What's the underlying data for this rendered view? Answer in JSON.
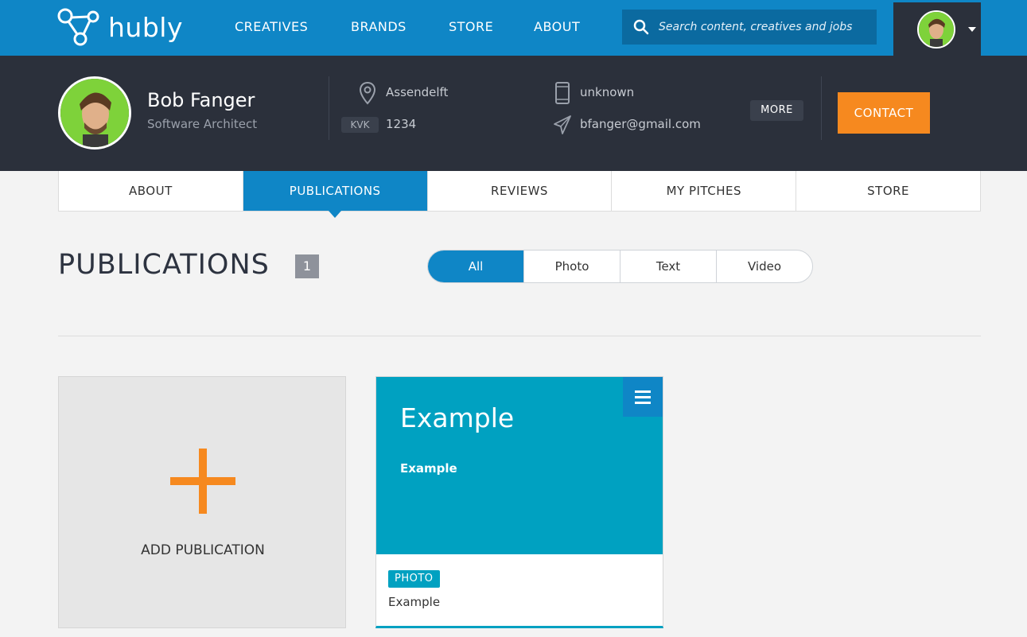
{
  "brand": {
    "name": "hubly"
  },
  "nav": {
    "links": [
      "CREATIVES",
      "BRANDS",
      "STORE",
      "ABOUT"
    ],
    "search_placeholder": "Search content, creatives and jobs"
  },
  "profile": {
    "name": "Bob Fanger",
    "role": "Software Architect",
    "location": "Assendelft",
    "kvk_label": "KVK",
    "kvk_value": "1234",
    "phone": "unknown",
    "email": "bfanger@gmail.com",
    "more_label": "MORE",
    "contact_label": "CONTACT"
  },
  "tabs": [
    {
      "label": "ABOUT",
      "active": false
    },
    {
      "label": "PUBLICATIONS",
      "active": true
    },
    {
      "label": "REVIEWS",
      "active": false
    },
    {
      "label": "MY PITCHES",
      "active": false
    },
    {
      "label": "STORE",
      "active": false
    }
  ],
  "publications": {
    "title": "PUBLICATIONS",
    "count": "1",
    "filters": [
      "All",
      "Photo",
      "Text",
      "Video"
    ],
    "active_filter": "All",
    "add_label": "ADD PUBLICATION",
    "items": [
      {
        "title": "Example",
        "subtitle": "Example",
        "type": "PHOTO",
        "caption": "Example"
      }
    ]
  },
  "colors": {
    "primary": "#0f86c6",
    "accent": "#f6891f",
    "dark": "#2b303b",
    "teal": "#00a1c1"
  }
}
